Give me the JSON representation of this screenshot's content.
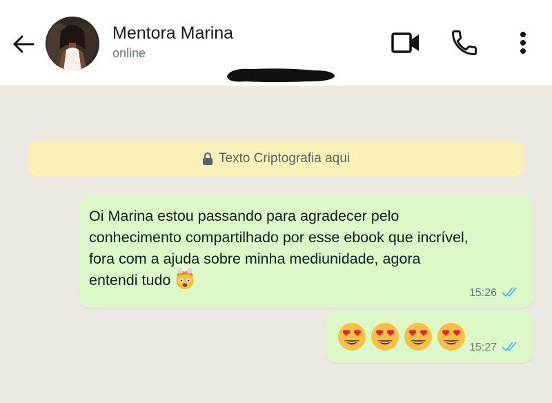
{
  "header": {
    "contact_name": "Mentora Marina",
    "status": "online"
  },
  "icons": {
    "back": "arrow-left-icon",
    "video": "video-camera-icon",
    "call": "phone-icon",
    "menu": "more-vertical-icon"
  },
  "notice": {
    "text": "Texto Criptografia aqui"
  },
  "messages": [
    {
      "text": "Oi Marina estou passando para agradecer pelo\nconhecimento compartilhado por esse ebook que incrível,\nfora com a ajuda sobre minha mediunidade, agora\nentendi tudo",
      "emoji": "🤯",
      "time": "15:26",
      "status": "read"
    },
    {
      "text": "😍😍😍😍",
      "time": "15:27",
      "status": "read"
    }
  ],
  "colors": {
    "outgoing_bubble": "#dcf8c6",
    "notice_bg": "#fbf0b8",
    "read_ticks": "#53bdeb",
    "chat_bg": "#ece8e2"
  }
}
